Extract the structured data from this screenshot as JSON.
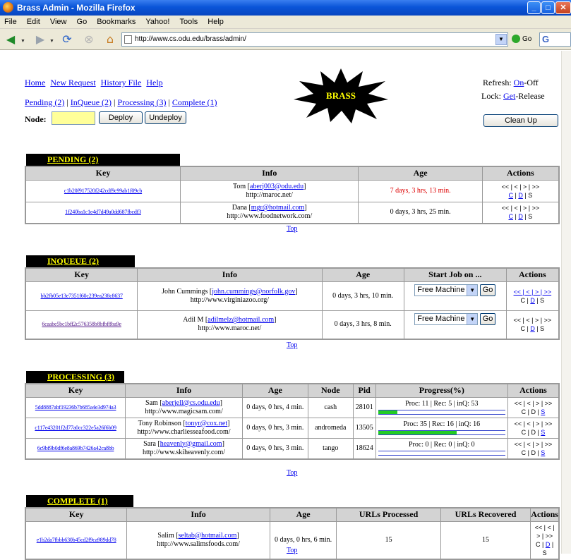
{
  "window": {
    "title": "Brass Admin - Mozilla Firefox"
  },
  "menu": [
    "File",
    "Edit",
    "View",
    "Go",
    "Bookmarks",
    "Yahoo!",
    "Tools",
    "Help"
  ],
  "browser": {
    "url": "http://www.cs.odu.edu/brass/admin/",
    "go_label": "Go",
    "search_logo": "G"
  },
  "header": {
    "nav_links": [
      "Home",
      "New Request",
      "History File",
      "Help"
    ],
    "status_links": [
      "Pending (2)",
      "InQueue (2)",
      "Processing (3)",
      "Complete (1)"
    ],
    "status_sep": "|",
    "node_label": "Node:",
    "node_value": "",
    "deploy_label": "Deploy",
    "undeploy_label": "Undeploy",
    "logo_text": "BRASS",
    "refresh_label": "Refresh:",
    "refresh_on": "On",
    "refresh_off": "-Off",
    "lock_label": "Lock:",
    "lock_get": "Get",
    "lock_release": "-Release",
    "cleanup_label": "Clean Up"
  },
  "colors": {
    "section_bg": "#000000",
    "section_text": "#ffff00",
    "header_bg": "#d3d3d3",
    "late_age": "#dd0000",
    "progress_fill": "#22cc22"
  },
  "top_link": "Top",
  "pending": {
    "title": "PENDING (2)",
    "columns": [
      "Key",
      "Info",
      "Age",
      "Actions"
    ],
    "rows": [
      {
        "key": "c1b20f917520f242cdf9c99ab1f09cb",
        "name": "Tom",
        "email": "aberj003@odu.edu",
        "url": "http://maroc.net/",
        "age": "7 days, 3 hrs, 13 min.",
        "late": true,
        "actions_top": "<< | < | > | >>",
        "actions_bottom": [
          "C",
          "D",
          "S"
        ]
      },
      {
        "key": "1f240ba1c1e4d7d49a0dd687fbcdf3",
        "name": "Dana",
        "email": "mgr@hotmail.com",
        "url": "http://www.foodnetwork.com/",
        "age": "0 days, 3 hrs, 25 min.",
        "late": false,
        "actions_top": "<< | < | > | >>",
        "actions_bottom": [
          "C",
          "D",
          "S"
        ]
      }
    ]
  },
  "inqueue": {
    "title": "INQUEUE (2)",
    "columns": [
      "Key",
      "Info",
      "Age",
      "Start Job on ...",
      "Actions"
    ],
    "rows": [
      {
        "key": "bb2fb05e13e7351f60c239ea238c8637",
        "name": "John Cummings",
        "email": "john.cummings@norfolk.gov",
        "url": "http://www.virginiazoo.org/",
        "age": "0 days, 3 hrs, 10 min.",
        "machine": "Free Machine",
        "go": "Go",
        "actions_top": "<< | < | > | >>",
        "actions_bottom": [
          "C",
          "D",
          "S"
        ]
      },
      {
        "key": "6caabe5bc1bff2c576358b8bfbf8ba9e",
        "name": "Adil M",
        "email": "adilmelz@hotmail.com",
        "url": "http://www.maroc.net/",
        "age": "0 days, 3 hrs, 8 min.",
        "machine": "Free Machine",
        "go": "Go",
        "actions_top": "<< | < | > | >>",
        "actions_bottom": [
          "C",
          "D",
          "S"
        ]
      }
    ]
  },
  "processing": {
    "title": "PROCESSING (3)",
    "columns": [
      "Key",
      "Info",
      "Age",
      "Node",
      "Pid",
      "Progress(%)",
      "Actions"
    ],
    "rows": [
      {
        "key": "5dd8887abf19236b7b685a4e3d974a3",
        "name": "Sam",
        "email": "aberjell@cs.odu.edu",
        "url": "http://www.magicsam.com/",
        "age": "0 days, 0 hrs, 4 min.",
        "node": "cash",
        "pid": "28101",
        "progress": "Proc: 11 | Rec: 5 | inQ: 53",
        "fraction": 0.15,
        "actions_top": "<< | < | > | >>",
        "actions_bottom": [
          "C",
          "D",
          "S"
        ]
      },
      {
        "key": "c117e43201f2d77a0cc322e5a26f6b09",
        "name": "Tony Robinson",
        "email": "tonyr@cox.net",
        "url": "http://www.charliesseafood.com/",
        "age": "0 days, 0 hrs, 3 min.",
        "node": "andromeda",
        "pid": "13505",
        "progress": "Proc: 35 | Rec: 16 | inQ: 16",
        "fraction": 0.62,
        "actions_top": "<< | < | > | >>",
        "actions_bottom": [
          "C",
          "D",
          "S"
        ]
      },
      {
        "key": "6c9bf9b0df6e8a869b7426a42ca8bb",
        "name": "Sara",
        "email": "heavenly@gmail.com",
        "url": "http://www.skiheavenly.com/",
        "age": "0 days, 0 hrs, 3 min.",
        "node": "tango",
        "pid": "18624",
        "progress": "Proc: 0 | Rec: 0 | inQ: 0",
        "fraction": 0.0,
        "actions_top": "<< | < | > | >>",
        "actions_bottom": [
          "C",
          "D",
          "S"
        ]
      }
    ]
  },
  "complete": {
    "title": "COMPLETE (1)",
    "columns": [
      "Key",
      "Info",
      "Age",
      "URLs Processed",
      "URLs Recovered",
      "Actions"
    ],
    "rows": [
      {
        "key": "e1b2da7fbbb630b45cd2f9ca989dd78",
        "name": "Salim",
        "email": "seltab@hotmail.com",
        "url": "http://www.salimsfoods.com/",
        "age": "0 days, 0 hrs, 6 min.",
        "processed": "15",
        "recovered": "15",
        "actions_top": "<< | < | > | >>",
        "actions_bottom": [
          "C",
          "D",
          "S"
        ]
      }
    ]
  }
}
